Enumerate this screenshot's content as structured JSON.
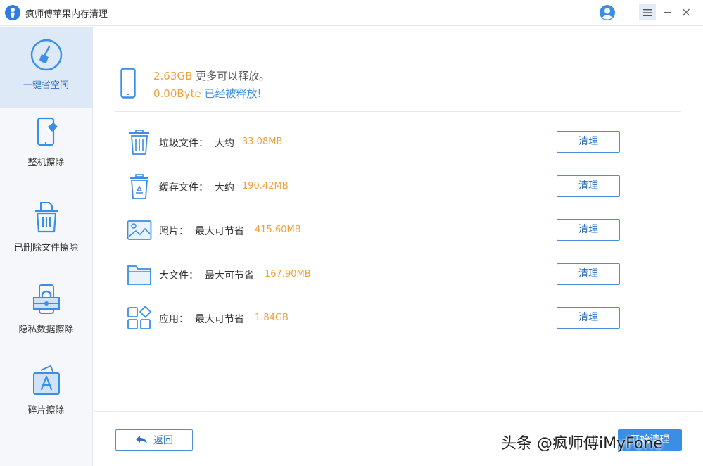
{
  "app": {
    "title": "疯师傅苹果内存清理"
  },
  "sidebar": {
    "items": [
      {
        "label": "一键省空间",
        "icon": "broom-icon",
        "active": true
      },
      {
        "label": "整机擦除",
        "icon": "phone-erase-icon",
        "active": false
      },
      {
        "label": "已删除文件擦除",
        "icon": "trash-file-icon",
        "active": false
      },
      {
        "label": "隐私数据擦除",
        "icon": "lock-icon",
        "active": false
      },
      {
        "label": "碎片擦除",
        "icon": "app-store-fragment-icon",
        "active": false
      }
    ]
  },
  "summary": {
    "freeable_amount": "2.63GB",
    "freeable_text": "更多可以释放。",
    "freed_amount": "0.00Byte",
    "freed_text": "已经被释放!"
  },
  "rows": [
    {
      "name": "垃圾文件：",
      "qualifier": "大约",
      "size": "33.08MB",
      "icon": "trash-can-icon",
      "button": "清理"
    },
    {
      "name": "缓存文件：",
      "qualifier": "大约",
      "size": "190.42MB",
      "icon": "recycle-bin-icon",
      "button": "清理"
    },
    {
      "name": "照片：",
      "qualifier": "最大可节省",
      "size": "415.60MB",
      "icon": "photo-icon",
      "button": "清理"
    },
    {
      "name": "大文件：",
      "qualifier": "最大可节省",
      "size": "167.90MB",
      "icon": "folder-icon",
      "button": "清理"
    },
    {
      "name": "应用：",
      "qualifier": "最大可节省",
      "size": "1.84GB",
      "icon": "apps-grid-icon",
      "button": "清理"
    }
  ],
  "footer": {
    "back_label": "返回",
    "primary_label": "开始清理"
  },
  "watermark": "头条 @疯师傅iMyFone",
  "colors": {
    "accent": "#3a8ee6",
    "highlight": "#f0a03a",
    "sidebar_active": "#dde9f7"
  }
}
